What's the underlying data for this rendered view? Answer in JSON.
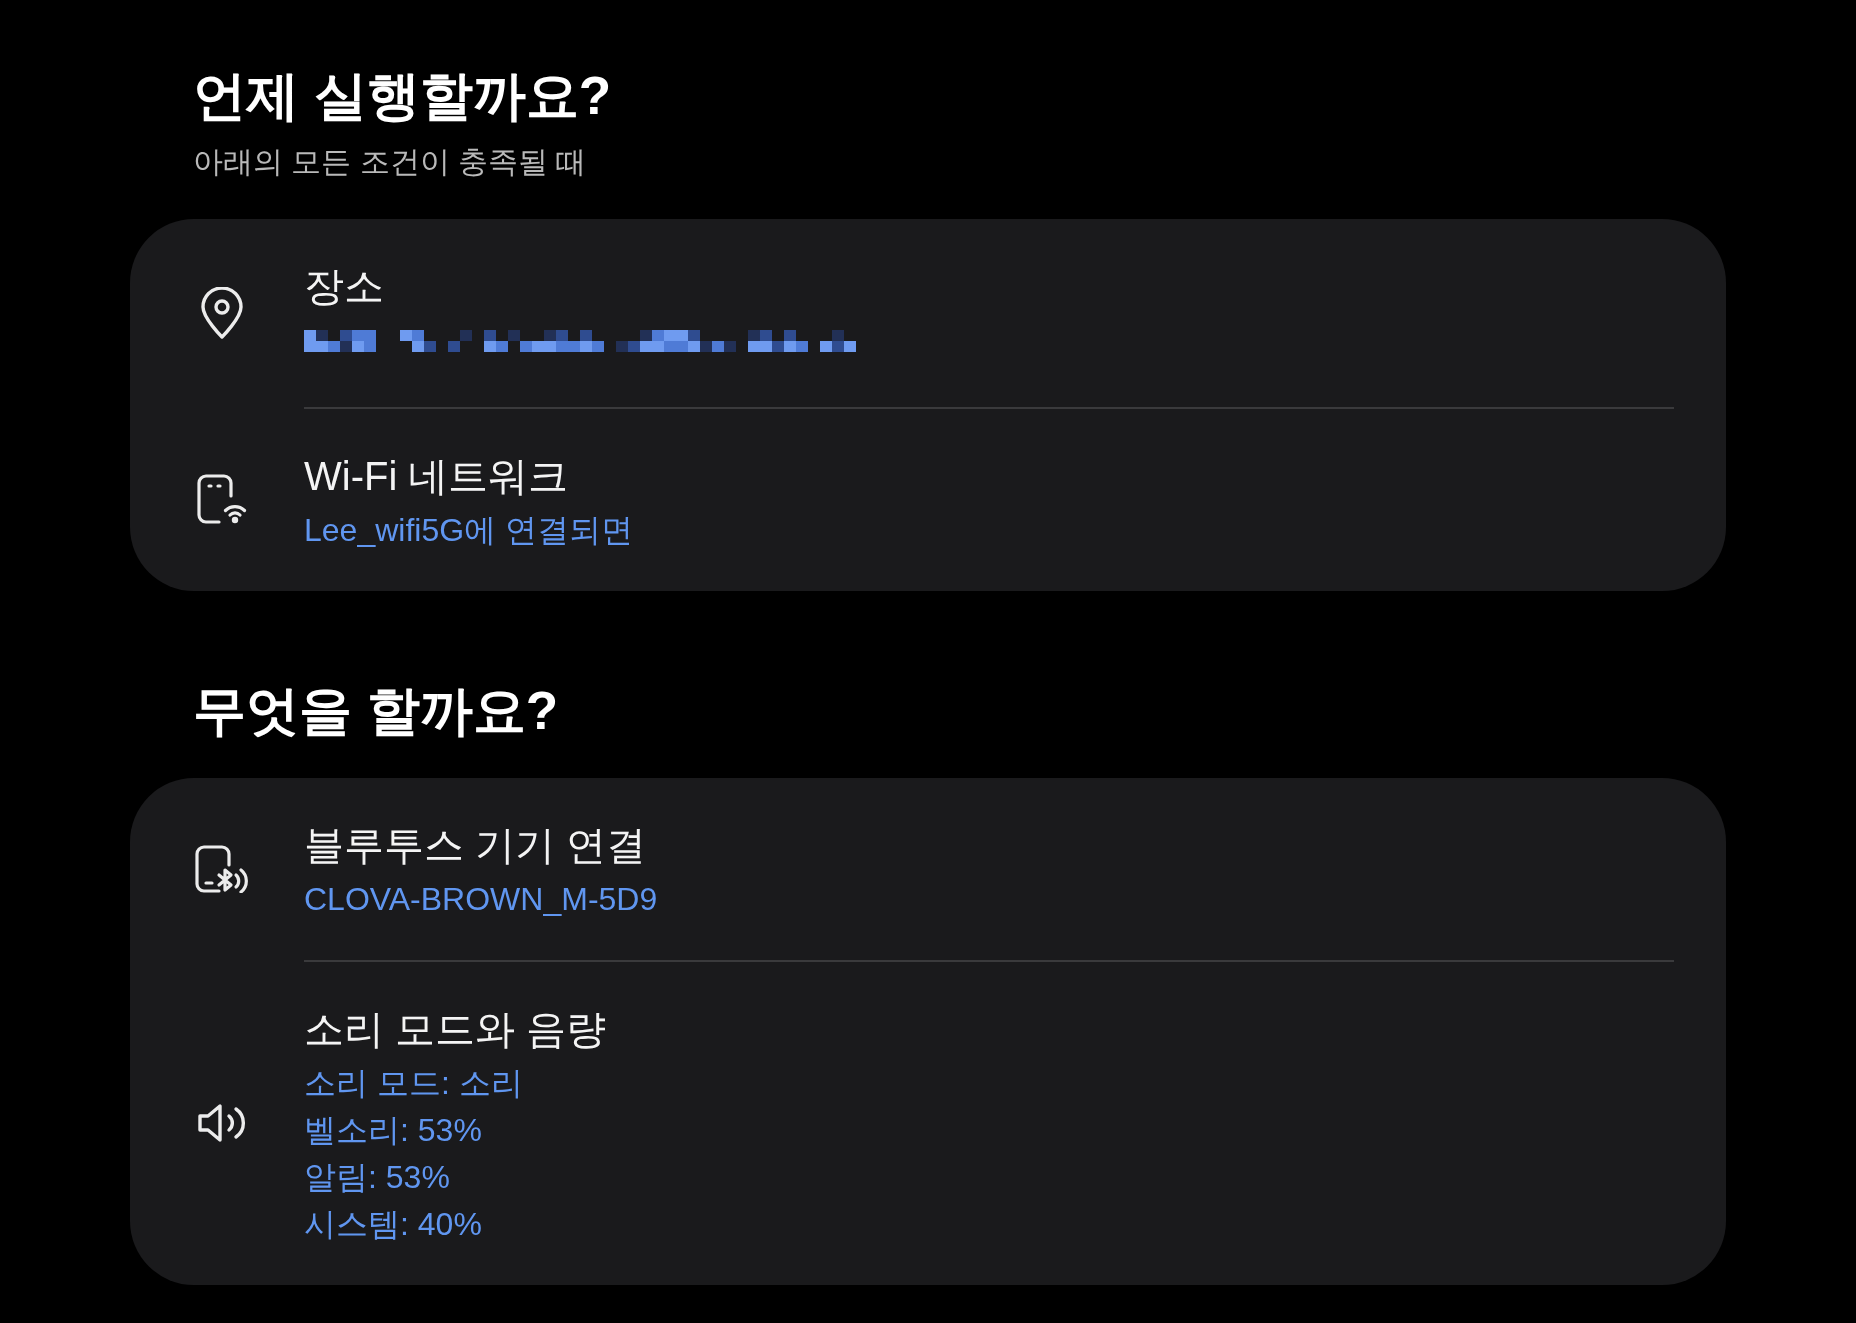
{
  "sections": [
    {
      "title": "언제 실행할까요?",
      "subtitle": "아래의 모든 조건이 충족될 때",
      "items": [
        {
          "kind": "location",
          "title": "장소",
          "redacted_detail": true
        },
        {
          "kind": "wifi",
          "title": "Wi-Fi 네트워크",
          "details": [
            "Lee_wifi5G에 연결되면"
          ]
        }
      ]
    },
    {
      "title": "무엇을 할까요?",
      "items": [
        {
          "kind": "bluetooth",
          "title": "블루투스 기기 연결",
          "details": [
            "CLOVA-BROWN_M-5D9"
          ]
        },
        {
          "kind": "sound",
          "title": "소리 모드와 음량",
          "details": [
            "소리 모드: 소리",
            "벨소리: 53%",
            "알림: 53%",
            "시스템: 40%"
          ]
        }
      ]
    }
  ]
}
